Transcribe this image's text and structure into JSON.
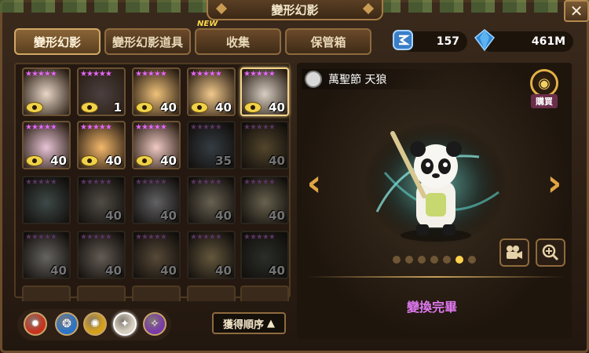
{
  "window": {
    "title": "變形幻影",
    "close_icon": "close-icon"
  },
  "tabs": [
    {
      "label": "變形幻影",
      "active": true
    },
    {
      "label": "變形幻影道具",
      "active": false
    },
    {
      "label": "收集",
      "active": false,
      "badge": "NEW"
    },
    {
      "label": "保管箱",
      "active": false
    }
  ],
  "currency": [
    {
      "icon": "rune-token-icon",
      "value": "157"
    },
    {
      "icon": "crystal-icon",
      "value": "461M"
    }
  ],
  "monsters": [
    {
      "stars": "★★★★★",
      "level": "",
      "eye": true,
      "dim": false,
      "selected": false,
      "color": "#e9d7c8"
    },
    {
      "stars": "★★★★★",
      "level": "1",
      "eye": true,
      "dim": false,
      "selected": false,
      "color": "#4a4040"
    },
    {
      "stars": "★★★★★",
      "level": "40",
      "eye": true,
      "dim": false,
      "selected": false,
      "color": "#f0c27a"
    },
    {
      "stars": "★★★★★",
      "level": "40",
      "eye": true,
      "dim": false,
      "selected": false,
      "color": "#f2c98c"
    },
    {
      "stars": "★★★★★",
      "level": "40",
      "eye": true,
      "dim": false,
      "selected": true,
      "color": "#d8cfc3"
    },
    {
      "stars": "★★★★★",
      "level": "40",
      "eye": true,
      "dim": false,
      "selected": false,
      "color": "#e8c4d6"
    },
    {
      "stars": "★★★★★",
      "level": "40",
      "eye": true,
      "dim": false,
      "selected": false,
      "color": "#f3b76a"
    },
    {
      "stars": "★★★★★",
      "level": "40",
      "eye": true,
      "dim": false,
      "selected": false,
      "color": "#f0c9c4"
    },
    {
      "stars": "★★★★★",
      "level": "35",
      "eye": false,
      "dim": true,
      "selected": false,
      "color": "#6a88a0"
    },
    {
      "stars": "★★★★★",
      "level": "40",
      "eye": false,
      "dim": true,
      "selected": false,
      "color": "#c99a3a"
    },
    {
      "stars": "★★★★★",
      "level": "",
      "eye": false,
      "dim": true,
      "selected": false,
      "color": "#7ca6a0"
    },
    {
      "stars": "★★★★★",
      "level": "40",
      "eye": false,
      "dim": true,
      "selected": false,
      "color": "#b8a890"
    },
    {
      "stars": "★★★★★",
      "level": "40",
      "eye": false,
      "dim": true,
      "selected": false,
      "color": "#d8d8e0"
    },
    {
      "stars": "★★★★★",
      "level": "40",
      "eye": false,
      "dim": true,
      "selected": false,
      "color": "#f0d8a0"
    },
    {
      "stars": "★★★★★",
      "level": "40",
      "eye": false,
      "dim": true,
      "selected": false,
      "color": "#f0d890"
    },
    {
      "stars": "★★★★★",
      "level": "40",
      "eye": false,
      "dim": true,
      "selected": false,
      "color": "#e8e0d0"
    },
    {
      "stars": "★★★★★",
      "level": "40",
      "eye": false,
      "dim": true,
      "selected": false,
      "color": "#e8c8b0"
    },
    {
      "stars": "★★★★★",
      "level": "40",
      "eye": false,
      "dim": true,
      "selected": false,
      "color": "#d0a060"
    },
    {
      "stars": "★★★★★",
      "level": "40",
      "eye": false,
      "dim": true,
      "selected": false,
      "color": "#f0c060"
    },
    {
      "stars": "★★★★★",
      "level": "40",
      "eye": false,
      "dim": true,
      "selected": false,
      "color": "#5a6a50"
    }
  ],
  "elements": [
    {
      "name": "fire-element-icon",
      "color": "#c8321e",
      "active": false
    },
    {
      "name": "water-element-icon",
      "color": "#2a74c8",
      "active": false
    },
    {
      "name": "wind-element-icon",
      "color": "#d6a018",
      "active": false
    },
    {
      "name": "light-element-icon",
      "color": "#d8d0c0",
      "active": true
    },
    {
      "name": "dark-element-icon",
      "color": "#7a3aa8",
      "active": false
    }
  ],
  "sort": {
    "label": "獲得順序",
    "arrow": "▲"
  },
  "detail": {
    "name": "萬聖節 天狼",
    "buy_label": "購買",
    "status": "變換完畢",
    "page_dots": 7,
    "active_dot": 5
  }
}
